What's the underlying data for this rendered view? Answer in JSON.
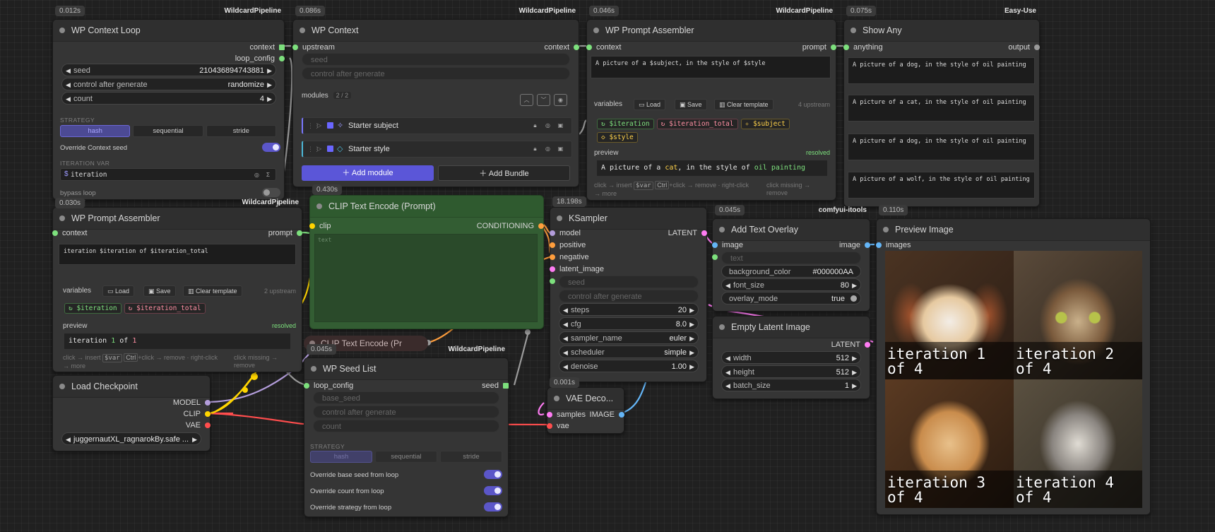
{
  "wp_context_loop": {
    "time": "0.012s",
    "source": "WildcardPipeline",
    "title": "WP Context Loop",
    "outputs": [
      "context",
      "loop_config"
    ],
    "seed_label": "seed",
    "seed_value": "210436894743881",
    "control_label": "control after generate",
    "control_value": "randomize",
    "count_label": "count",
    "count_value": "4",
    "strategy_label": "STRATEGY",
    "strategy_options": [
      "hash",
      "sequential",
      "stride"
    ],
    "override_label": "Override Context seed",
    "iteration_var_label": "ITERATION VAR",
    "iteration_var_value": "iteration",
    "bypass_label": "bypass loop"
  },
  "wp_context": {
    "time": "0.086s",
    "source": "WildcardPipeline",
    "title": "WP Context",
    "input": "upstream",
    "output": "context",
    "seed_placeholder": "seed",
    "control_placeholder": "control after generate",
    "modules_label": "modules",
    "modules_count": "2 / 2",
    "modules": [
      {
        "name": "Starter subject",
        "icon": "sparkle-icon"
      },
      {
        "name": "Starter style",
        "icon": "tag-icon"
      }
    ],
    "add_module": "Add module",
    "add_bundle": "Add Bundle"
  },
  "wp_prompt_assembler_top": {
    "source": "WildcardPipeline",
    "time": "0.046s",
    "title": "WP Prompt Assembler",
    "input": "context",
    "output": "prompt",
    "template": "A picture of a $subject, in the style of $style",
    "variables_label": "variables",
    "load": "Load",
    "save": "Save",
    "clear": "Clear template",
    "upstream": "4 upstream",
    "chips": [
      "$iteration",
      "$iteration_total",
      "$subject",
      "$style"
    ],
    "preview_label": "preview",
    "resolved": "resolved",
    "preview_parts": [
      "A picture of a ",
      "cat",
      ", in the style of ",
      "oil painting"
    ],
    "hint_left": [
      "click → insert",
      "$var",
      "Ctrl",
      "+click → remove · right-click → more"
    ],
    "hint_right": "click missing → remove"
  },
  "show_any": {
    "time": "0.075s",
    "source": "Easy-Use",
    "title": "Show Any",
    "input": "anything",
    "output": "output",
    "items": [
      "A picture of a dog, in the style of oil painting",
      "A picture of a cat, in the style of oil painting",
      "A picture of a dog, in the style of oil painting",
      "A picture of a wolf, in the style of oil painting"
    ]
  },
  "wp_prompt_assembler_left": {
    "time": "0.030s",
    "source": "WildcardPipeline",
    "title": "WP Prompt Assembler",
    "input": "context",
    "output": "prompt",
    "template": "iteration $iteration of $iteration_total",
    "variables_label": "variables",
    "load": "Load",
    "save": "Save",
    "clear": "Clear template",
    "upstream": "2 upstream",
    "chips": [
      "$iteration",
      "$iteration_total"
    ],
    "preview_label": "preview",
    "resolved": "resolved",
    "preview_parts": [
      "iteration ",
      "1",
      " of ",
      "1"
    ],
    "hint_left": [
      "click → insert",
      "$var",
      "Ctrl",
      "+click → remove · right-click → more"
    ],
    "hint_right": "click missing → remove"
  },
  "clip_text_encode": {
    "time": "0.430s",
    "title": "CLIP Text Encode (Prompt)",
    "input": "clip",
    "output": "CONDITIONING",
    "placeholder": "text"
  },
  "clip_text_encode_collapsed": {
    "title": "CLIP Text Encode (Pr"
  },
  "ksampler": {
    "time": "18.198s",
    "title": "KSampler",
    "inputs": [
      "model",
      "positive",
      "negative",
      "latent_image"
    ],
    "output": "LATENT",
    "seed_placeholder": "seed",
    "control_placeholder": "control after generate",
    "widgets": [
      {
        "label": "steps",
        "value": "20"
      },
      {
        "label": "cfg",
        "value": "8.0"
      },
      {
        "label": "sampler_name",
        "value": "euler"
      },
      {
        "label": "scheduler",
        "value": "simple"
      },
      {
        "label": "denoise",
        "value": "1.00"
      }
    ]
  },
  "add_text_overlay": {
    "time": "0.045s",
    "source": "comfyui-itools",
    "title": "Add Text Overlay",
    "input": "image",
    "output": "image",
    "text_placeholder": "text",
    "widgets": [
      {
        "label": "background_color",
        "value": "#000000AA"
      },
      {
        "label": "font_size",
        "value": "80"
      },
      {
        "label": "overlay_mode",
        "value": "true"
      }
    ]
  },
  "empty_latent": {
    "title": "Empty Latent Image",
    "output": "LATENT",
    "widgets": [
      {
        "label": "width",
        "value": "512"
      },
      {
        "label": "height",
        "value": "512"
      },
      {
        "label": "batch_size",
        "value": "1"
      }
    ]
  },
  "preview_image": {
    "time": "0.110s",
    "title": "Preview Image",
    "input": "images",
    "captions": [
      "iteration 1\nof 4",
      "iteration 2\nof 4",
      "iteration 3\nof 4",
      "iteration 4\nof 4"
    ]
  },
  "load_checkpoint": {
    "title": "Load Checkpoint",
    "outputs": [
      "MODEL",
      "CLIP",
      "VAE"
    ],
    "ckpt": "juggernautXL_ragnarokBy.safe ..."
  },
  "wp_seed_list": {
    "time": "0.045s",
    "source": "WildcardPipeline",
    "title": "WP Seed List",
    "input": "loop_config",
    "output": "seed",
    "placeholders": [
      "base_seed",
      "control after generate",
      "count"
    ],
    "strategy_label": "STRATEGY",
    "strategy_options": [
      "hash",
      "sequential",
      "stride"
    ],
    "toggles": [
      "Override base seed from loop",
      "Override count from loop",
      "Override strategy from loop"
    ]
  },
  "vae_decode": {
    "time": "0.001s",
    "title": "VAE Deco...",
    "inputs": [
      "samples",
      "vae"
    ],
    "output": "IMAGE"
  },
  "colors": {
    "accent": "#5b56d8",
    "node_bg": "#353535",
    "clip_green": "#335d33",
    "canvas": "#202020"
  }
}
